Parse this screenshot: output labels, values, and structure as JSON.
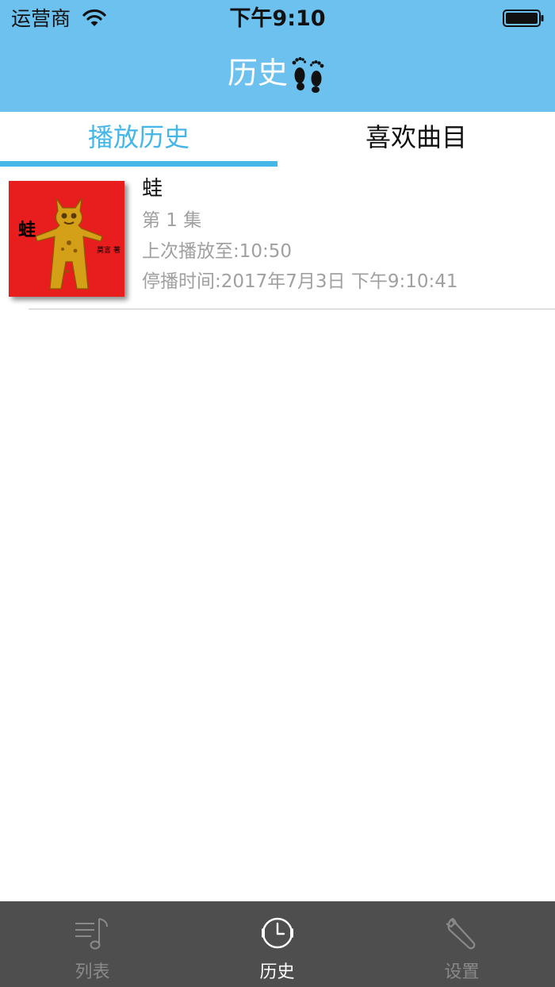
{
  "status_bar": {
    "carrier": "运营商",
    "time": "下午9:10",
    "wifi_icon": "wifi-icon",
    "battery_icon": "battery-icon"
  },
  "nav": {
    "title": "历史",
    "title_icon": "footprints-icon",
    "background_color": "#6cc1ee"
  },
  "tabs": [
    {
      "label": "播放历史",
      "active": true,
      "color": "#45b6e8"
    },
    {
      "label": "喜欢曲目",
      "active": false,
      "color": "#111111"
    }
  ],
  "history_items": [
    {
      "title": "蛙",
      "episode": "第 1 集",
      "last_position": "上次播放至:10:50",
      "stopped_at": "停播时间:2017年7月3日 下午9:10:41",
      "cover": {
        "title": "蛙",
        "author": "莫言 著",
        "background_color": "#e81d1d"
      }
    }
  ],
  "tab_bar": {
    "items": [
      {
        "label": "列表",
        "icon": "music-list-icon",
        "selected": false
      },
      {
        "label": "历史",
        "icon": "clock-icon",
        "selected": true
      },
      {
        "label": "设置",
        "icon": "wrench-icon",
        "selected": false
      }
    ]
  }
}
